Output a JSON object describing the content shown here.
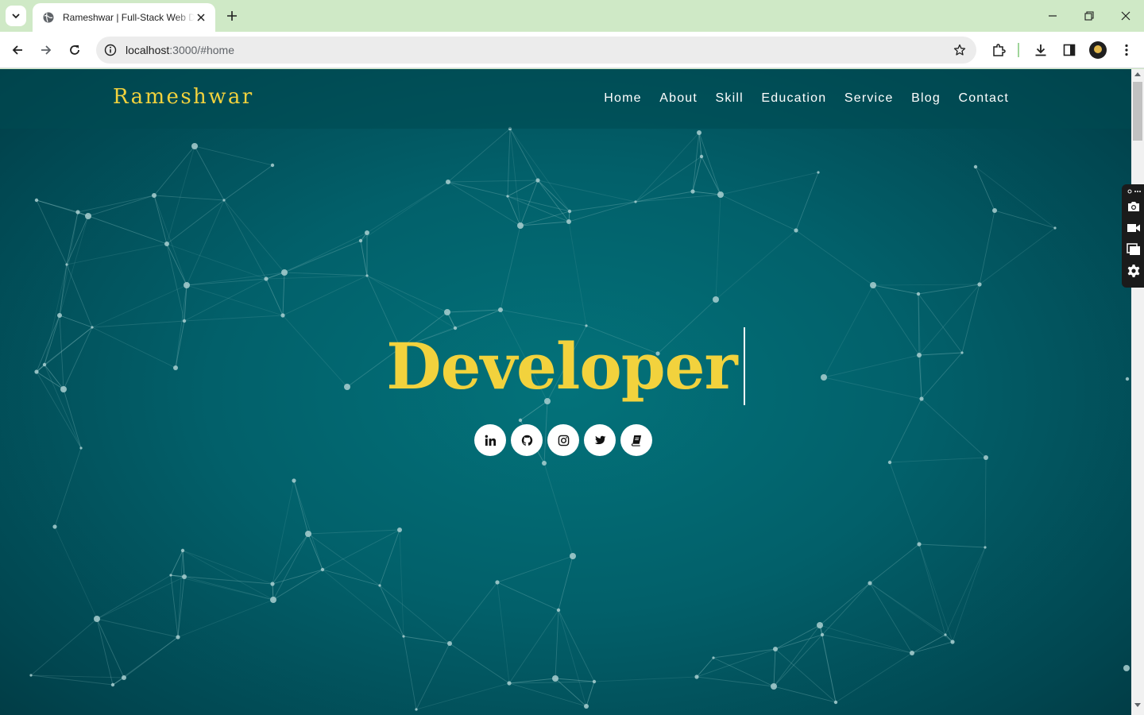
{
  "browser": {
    "tab_title": "Rameshwar | Full-Stack Web Developer",
    "url_host": "localhost",
    "url_rest": ":3000/#home",
    "icons": [
      "tab-search-icon",
      "globe-icon",
      "close-icon",
      "plus-icon",
      "minimize-icon",
      "restore-icon",
      "back-icon",
      "forward-icon",
      "reload-icon",
      "info-icon",
      "star-icon",
      "extensions-icon",
      "download-icon",
      "side-panel-icon",
      "menu-icon"
    ]
  },
  "site": {
    "brand": "Rameshwar",
    "nav": [
      "Home",
      "About",
      "Skill",
      "Education",
      "Service",
      "Blog",
      "Contact"
    ],
    "hero_word": "Developer",
    "socials": [
      "linkedin-icon",
      "github-icon",
      "instagram-icon",
      "twitter-icon",
      "book-icon"
    ],
    "colors": {
      "accent": "#f2d23d",
      "background": "#02606a",
      "network_lines": "#8fc3c4",
      "social_bg": "#ffffff"
    }
  },
  "side_panel": {
    "icons": [
      "camera-icon",
      "video-icon",
      "window-icon",
      "settings-icon"
    ]
  }
}
